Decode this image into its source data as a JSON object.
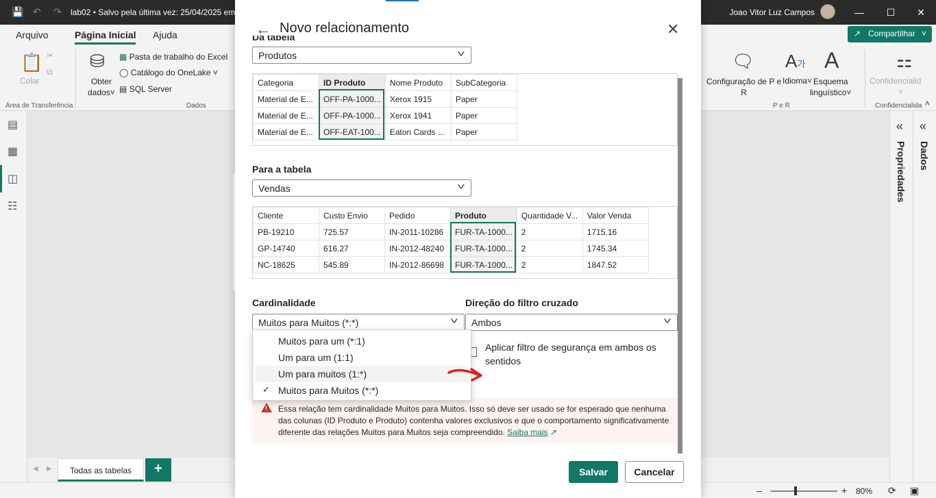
{
  "titlebar": {
    "doc_title": "lab02 • Salvo pela última vez: 25/04/2025 em",
    "user_name": "Joao Vitor Luz Campos",
    "icons": [
      "save-icon",
      "undo-icon",
      "redo-icon",
      "minimize-icon",
      "maximize-icon",
      "close-icon"
    ]
  },
  "ribbon": {
    "tabs": [
      "Arquivo",
      "Página Inicial",
      "Ajuda"
    ],
    "active_tab": "Página Inicial",
    "share_label": "Compartilhar",
    "clipboard": {
      "paste": "Colar",
      "group": "Área de Transferência"
    },
    "data": {
      "get_data_line1": "Obter",
      "get_data_line2": "dados",
      "excel": "Pasta de trabalho do Excel",
      "onelake": "Catálogo do OneLake",
      "sql": "SQL Server",
      "group": "Dados"
    },
    "qa": {
      "config_line1": "Configuração de P e",
      "config_line2": "R",
      "language": "Idioma",
      "schema_line1": "Esquema",
      "schema_line2": "linguístico",
      "group": "P e R"
    },
    "sensitivity": {
      "label": "Confidencialid",
      "group": "Confidencialida"
    }
  },
  "right_panes": {
    "properties": "Propriedades",
    "data": "Dados"
  },
  "bottom": {
    "page_tab": "Todas as tabelas",
    "add_page": "+"
  },
  "status": {
    "zoom": "80%"
  },
  "dialog": {
    "title": "Novo relacionamento",
    "from_label": "Da tabela",
    "from_table": "Produtos",
    "from_preview": {
      "columns": [
        "Categoria",
        "ID Produto",
        "Nome Produto",
        "SubCategoria"
      ],
      "key_column": 1,
      "rows": [
        [
          "Material de E...",
          "OFF-PA-1000...",
          "Xerox 1915",
          "Paper"
        ],
        [
          "Material de E...",
          "OFF-PA-1000...",
          "Xerox 1941",
          "Paper"
        ],
        [
          "Material de E...",
          "OFF-EAT-100...",
          "Eaton Cards ...",
          "Paper"
        ]
      ]
    },
    "to_label": "Para a tabela",
    "to_table": "Vendas",
    "to_preview": {
      "columns": [
        "Cliente",
        "Custo Envio",
        "Pedido",
        "Produto",
        "Quantidade V...",
        "Valor Venda"
      ],
      "key_column": 3,
      "rows": [
        [
          "PB-19210",
          "725.57",
          "IN-2011-10286",
          "FUR-TA-1000...",
          "2",
          "1715.16"
        ],
        [
          "GP-14740",
          "616.27",
          "IN-2012-48240",
          "FUR-TA-1000...",
          "2",
          "1745.34"
        ],
        [
          "NC-18625",
          "545.89",
          "IN-2012-86698",
          "FUR-TA-1000...",
          "2",
          "1847.52"
        ]
      ]
    },
    "cardinality_label": "Cardinalidade",
    "cardinality_value": "Muitos para Muitos (*:*)",
    "cardinality_options": [
      "Muitos para um (*:1)",
      "Um para um (1:1)",
      "Um para muitos (1:*)",
      "Muitos para Muitos (*:*)"
    ],
    "cardinality_selected": 3,
    "cardinality_hover": 2,
    "filter_label": "Direção do filtro cruzado",
    "filter_value": "Ambos",
    "security_checkbox": "Aplicar filtro de segurança em ambos os sentidos",
    "warning_text": "Essa relação tem cardinalidade Muitos para Muitos. Isso só deve ser usado se for esperado que nenhuma das colunas (ID Produto e Produto) contenha valores exclusivos e que o comportamento significativamente diferente das relações Muitos para Muitos seja compreendido.",
    "warning_link": "Saiba mais",
    "save_label": "Salvar",
    "cancel_label": "Cancelar"
  },
  "colors": {
    "accent": "#117865",
    "warning": "#c8352a",
    "warning_bg": "#fdf3f1",
    "annotation": "#e0201b"
  }
}
